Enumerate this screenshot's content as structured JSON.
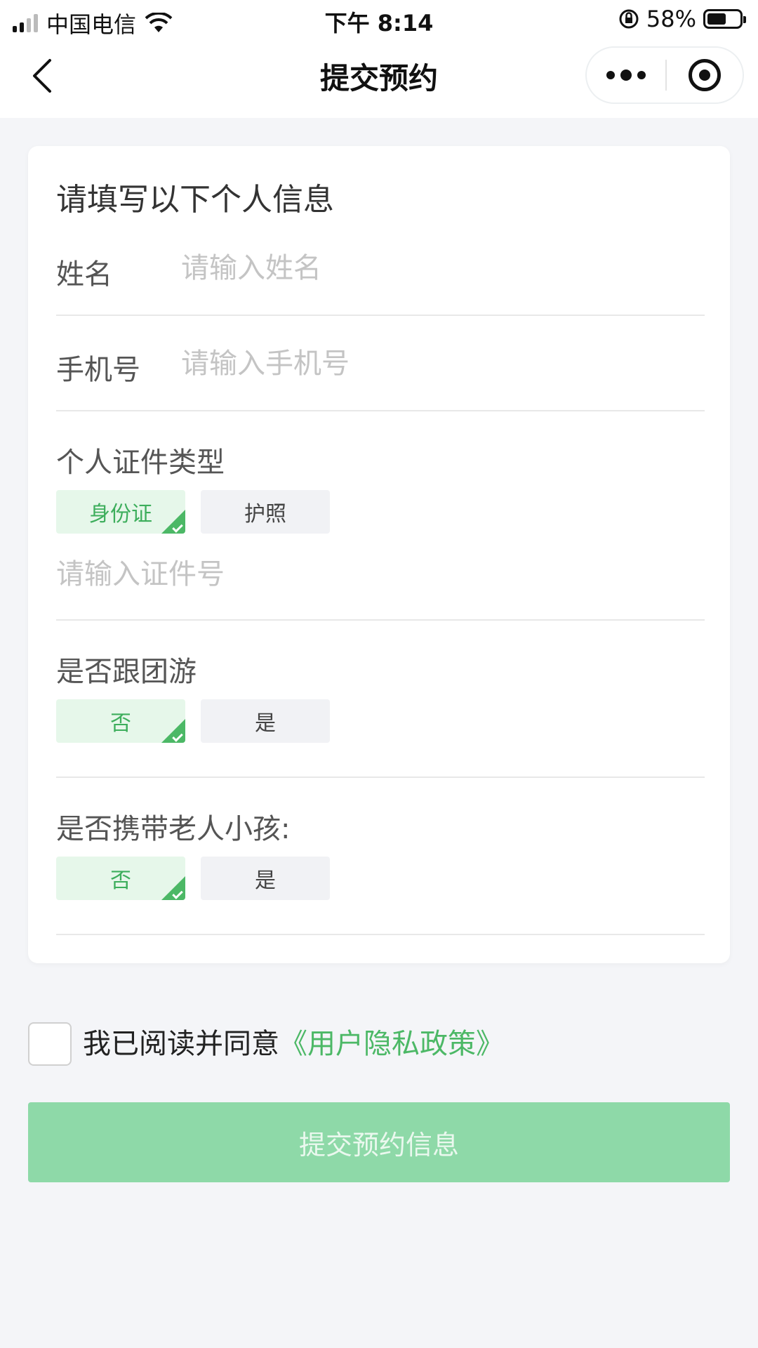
{
  "status_bar": {
    "carrier": "中国电信",
    "time": "下午 8:14",
    "battery": "58%",
    "battery_level": 0.58
  },
  "nav": {
    "title": "提交预约",
    "back_icon": "chevron-left-icon",
    "more_icon": "more-dots-icon",
    "close_icon": "target-circle-icon"
  },
  "form": {
    "title": "请填写以下个人信息",
    "name": {
      "label": "姓名",
      "placeholder": "请输入姓名",
      "value": ""
    },
    "phone": {
      "label": "手机号",
      "placeholder": "请输入手机号",
      "value": ""
    },
    "id_type": {
      "label": "个人证件类型",
      "options": [
        "身份证",
        "护照"
      ],
      "selected": "身份证",
      "id_placeholder": "请输入证件号"
    },
    "group_tour": {
      "label": "是否跟团游",
      "options": [
        "否",
        "是"
      ],
      "selected": "否"
    },
    "elderly_children": {
      "label": "是否携带老人小孩:",
      "options": [
        "否",
        "是"
      ],
      "selected": "否"
    }
  },
  "agreement": {
    "text": "我已阅读并同意",
    "link": "《用户隐私政策》",
    "checked": false
  },
  "submit": {
    "label": "提交预约信息"
  },
  "colors": {
    "accent": "#4cb866",
    "submit_disabled": "#8ed9a8",
    "selected_bg": "#e6f7ea",
    "page_bg": "#f4f5f8"
  }
}
